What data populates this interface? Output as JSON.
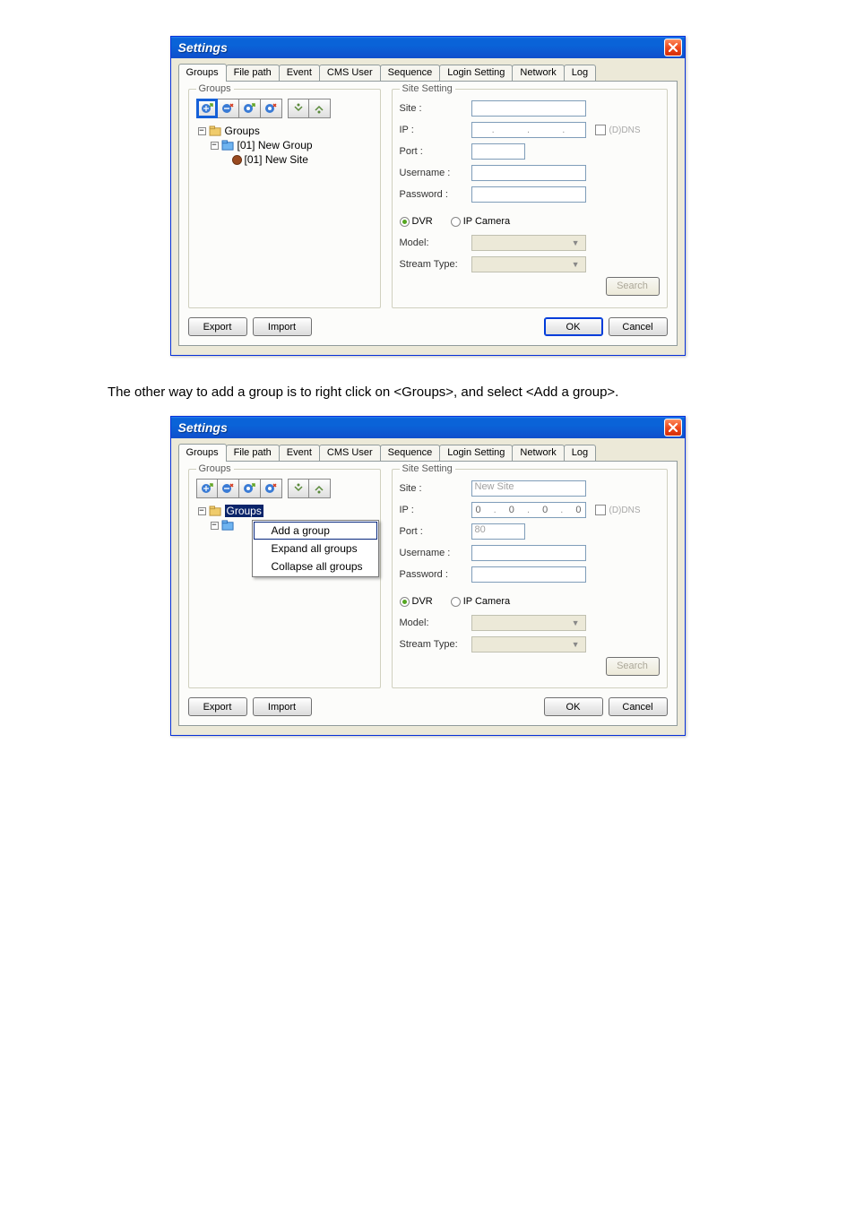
{
  "dialog": {
    "title": "Settings",
    "tabs": [
      "Groups",
      "File path",
      "Event",
      "CMS User",
      "Sequence",
      "Login Setting",
      "Network",
      "Log"
    ],
    "buttons": {
      "export": "Export",
      "import": "Import",
      "ok": "OK",
      "cancel": "Cancel",
      "search": "Search"
    }
  },
  "groups_panel": {
    "legend": "Groups",
    "tree_root": "Groups",
    "tree_group": "[01] New Group",
    "tree_site": "[01] New Site"
  },
  "site_panel": {
    "legend": "Site Setting",
    "labels": {
      "site": "Site :",
      "ip": "IP :",
      "port": "Port :",
      "username": "Username :",
      "password": "Password :",
      "model": "Model:",
      "stream": "Stream Type:",
      "dvr": "DVR",
      "ipcam": "IP Camera",
      "ddns": "(D)DNS"
    }
  },
  "screenshot1": {
    "site_value": "",
    "ip": [
      "",
      "",
      "",
      ""
    ],
    "port_value": ""
  },
  "screenshot2": {
    "site_value": "New Site",
    "ip": [
      "0",
      "0",
      "0",
      "0"
    ],
    "port_value": "80",
    "context_menu": [
      "Add a group",
      "Expand all groups",
      "Collapse all groups"
    ]
  },
  "doc_text": "The other way to add a group is to right click on <Groups>, and select <Add a group>."
}
